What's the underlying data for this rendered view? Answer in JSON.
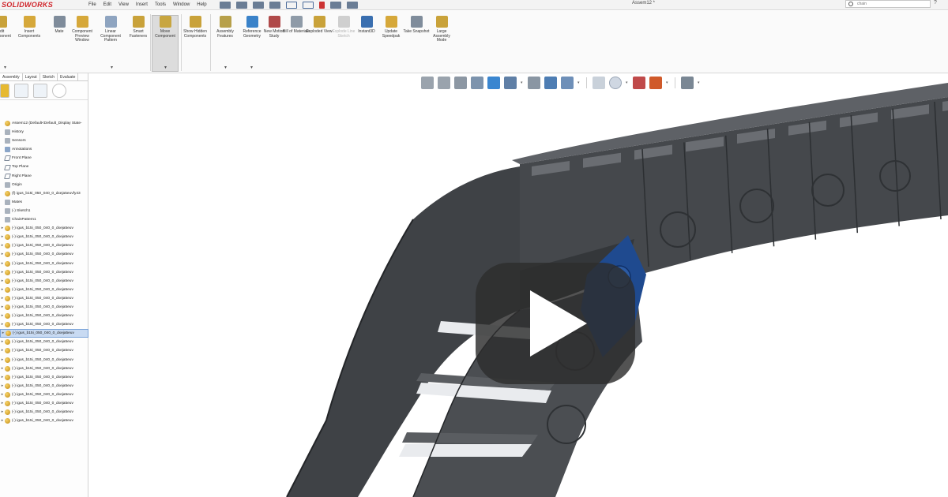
{
  "app": {
    "logo_text": "SOLIDWORKS",
    "document_title": "Assem12 *",
    "search_placeholder": "chain",
    "help": "?"
  },
  "menu": [
    "File",
    "Edit",
    "View",
    "Insert",
    "Tools",
    "Window",
    "Help"
  ],
  "ribbon": {
    "buttons": [
      {
        "label": "Edit Component",
        "icon": "edit-component-icon",
        "active": false,
        "disabled": false
      },
      {
        "label": "Insert Components",
        "icon": "insert-components-icon",
        "active": false,
        "disabled": false
      },
      {
        "label": "Mate",
        "icon": "mate-icon",
        "active": false,
        "disabled": false
      },
      {
        "label": "Component Preview Window",
        "icon": "component-preview-icon",
        "active": false,
        "disabled": false
      },
      {
        "label": "Linear Component Pattern",
        "icon": "linear-pattern-icon",
        "active": false,
        "disabled": false
      },
      {
        "label": "Smart Fasteners",
        "icon": "smart-fasteners-icon",
        "active": false,
        "disabled": false
      },
      {
        "label": "Move Component",
        "icon": "move-component-icon",
        "active": true,
        "disabled": false
      },
      {
        "label": "Show Hidden Components",
        "icon": "show-hidden-icon",
        "active": false,
        "disabled": false
      },
      {
        "label": "Assembly Features",
        "icon": "assembly-features-icon",
        "active": false,
        "disabled": false
      },
      {
        "label": "Reference Geometry",
        "icon": "reference-geometry-icon",
        "active": false,
        "disabled": false
      },
      {
        "label": "New Motion Study",
        "icon": "motion-study-icon",
        "active": false,
        "disabled": false
      },
      {
        "label": "Bill of Materials",
        "icon": "bom-icon",
        "active": false,
        "disabled": false
      },
      {
        "label": "Exploded View",
        "icon": "exploded-view-icon",
        "active": false,
        "disabled": false
      },
      {
        "label": "Explode Line Sketch",
        "icon": "explode-line-icon",
        "active": false,
        "disabled": true
      },
      {
        "label": "Instant3D",
        "icon": "instant3d-icon",
        "active": false,
        "disabled": false
      },
      {
        "label": "Update Speedpak",
        "icon": "speedpak-icon",
        "active": false,
        "disabled": false
      },
      {
        "label": "Take Snapshot",
        "icon": "snapshot-icon",
        "active": false,
        "disabled": false
      },
      {
        "label": "Large Assembly Mode",
        "icon": "large-assembly-icon",
        "active": false,
        "disabled": false
      }
    ]
  },
  "panel": {
    "tabs": [
      "Assembly",
      "Layout",
      "Sketch",
      "Evaluate"
    ],
    "tree": [
      {
        "label": "Assem12  (Default<Default_Display State-",
        "icon": "assembly",
        "indent": 0
      },
      {
        "label": "History",
        "icon": "history",
        "indent": 0
      },
      {
        "label": "Sensors",
        "icon": "sensors",
        "indent": 0
      },
      {
        "label": "Annotations",
        "icon": "annotations",
        "indent": 0
      },
      {
        "label": "Front Plane",
        "icon": "plane",
        "indent": 0
      },
      {
        "label": "Top Plane",
        "icon": "plane",
        "indent": 0
      },
      {
        "label": "Right Plane",
        "icon": "plane",
        "indent": 0
      },
      {
        "label": "Origin",
        "icon": "origin",
        "indent": 0
      },
      {
        "label": "(f) igus_b15i_050_040_0_dxeja5euvfy43",
        "icon": "part",
        "indent": 0
      },
      {
        "label": "Mates",
        "icon": "mates",
        "indent": 0
      },
      {
        "label": "(-) Sketch1",
        "icon": "sketch",
        "indent": 0
      },
      {
        "label": "ChainPattern1",
        "icon": "pattern",
        "indent": 0
      },
      {
        "label": "(-) igus_b15i_050_040_0_dxeja5euv",
        "icon": "part",
        "indent": 1
      },
      {
        "label": "(-) igus_b15i_050_040_0_dxeja5euv",
        "icon": "part",
        "indent": 1
      },
      {
        "label": "(-) igus_b15i_050_040_0_dxeja5euv",
        "icon": "part",
        "indent": 1
      },
      {
        "label": "(-) igus_b15i_050_040_0_dxeja5euv",
        "icon": "part",
        "indent": 1
      },
      {
        "label": "(-) igus_b15i_050_040_0_dxeja5euv",
        "icon": "part",
        "indent": 1
      },
      {
        "label": "(-) igus_b15i_050_040_0_dxeja5euv",
        "icon": "part",
        "indent": 1
      },
      {
        "label": "(-) igus_b15i_050_040_0_dxeja5euv",
        "icon": "part",
        "indent": 1
      },
      {
        "label": "(-) igus_b15i_050_040_0_dxeja5euv",
        "icon": "part",
        "indent": 1
      },
      {
        "label": "(-) igus_b15i_050_040_0_dxeja5euv",
        "icon": "part",
        "indent": 1
      },
      {
        "label": "(-) igus_b15i_050_040_0_dxeja5euv",
        "icon": "part",
        "indent": 1
      },
      {
        "label": "(-) igus_b15i_050_040_0_dxeja5euv",
        "icon": "part",
        "indent": 1
      },
      {
        "label": "(-) igus_b15i_050_040_0_dxeja5euv",
        "icon": "part",
        "indent": 1
      },
      {
        "label": "(-) igus_b15i_050_040_0_dxeja5euv",
        "icon": "part",
        "indent": 1,
        "selected": true
      },
      {
        "label": "(-) igus_b15i_050_040_0_dxeja5euv",
        "icon": "part",
        "indent": 1
      },
      {
        "label": "(-) igus_b15i_050_040_0_dxeja5euv",
        "icon": "part",
        "indent": 1
      },
      {
        "label": "(-) igus_b15i_050_040_0_dxeja5euv",
        "icon": "part",
        "indent": 1
      },
      {
        "label": "(-) igus_b15i_050_040_0_dxeja5euv",
        "icon": "part",
        "indent": 1
      },
      {
        "label": "(-) igus_b15i_050_040_0_dxeja5euv",
        "icon": "part",
        "indent": 1
      },
      {
        "label": "(-) igus_b15i_050_040_0_dxeja5euv",
        "icon": "part",
        "indent": 1
      },
      {
        "label": "(-) igus_b15i_050_040_0_dxeja5euv",
        "icon": "part",
        "indent": 1
      },
      {
        "label": "(-) igus_b15i_050_040_0_dxeja5euv",
        "icon": "part",
        "indent": 1
      },
      {
        "label": "(-) igus_b15i_050_040_0_dxeja5euv",
        "icon": "part",
        "indent": 1
      },
      {
        "label": "(-) igus_b15i_050_040_0_dxeja5euv",
        "icon": "part",
        "indent": 1
      }
    ]
  },
  "heads_up_toolbar": [
    "zoom-to-fit-icon",
    "zoom-to-area-icon",
    "previous-view-icon",
    "section-view-icon",
    "view-orientation-icon",
    "display-style-icon",
    "hide-show-items-icon",
    "edit-appearance-icon",
    "apply-scene-icon",
    "view-settings-icon",
    "realview-icon",
    "appearance-sphere-icon",
    "scene-icon",
    "display-monitor-icon"
  ],
  "colors": {
    "chain_body": "#4c4f53",
    "chain_dark": "#323538",
    "selected_link": "#1f4a8f",
    "brand_red": "#d0252b",
    "video_overlay": "#2d2d2d"
  },
  "video": {
    "play_icon": "play-button-icon"
  }
}
